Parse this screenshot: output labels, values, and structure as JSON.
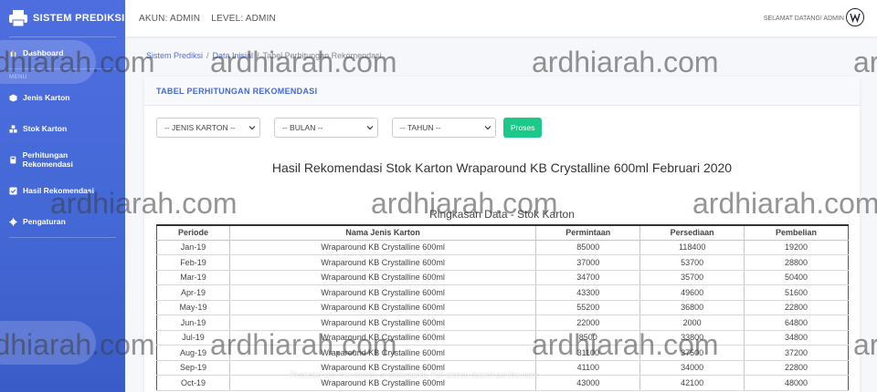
{
  "sidebar": {
    "brand": "SISTEM PREDIKSI",
    "dashboard": "Dashboard",
    "menu_heading": "MENU",
    "items": [
      {
        "label": "Jenis Karton",
        "icon": "box-icon"
      },
      {
        "label": "Stok Karton",
        "icon": "cubes-icon"
      },
      {
        "label": "Perhitungan Rekomendasi",
        "icon": "calculator-icon"
      },
      {
        "label": "Hasil Rekomendasi",
        "icon": "check-square-icon"
      },
      {
        "label": "Pengaturan",
        "icon": "gear-icon"
      }
    ]
  },
  "topbar": {
    "account": "AKUN: ADMIN",
    "level": "LEVEL: ADMIN",
    "greeting": "SELAMAT DATANG! ADMIN"
  },
  "breadcrumb": {
    "root": "Sistem Prediksi",
    "middle": "Data Inisial",
    "current": "Tabel Perhitungan Rekomendasi"
  },
  "card": {
    "header": "TABEL PERHITUNGAN REKOMENDASI",
    "filters": {
      "jenis": "-- JENIS KARTON --",
      "bulan": "-- BULAN --",
      "tahun": "-- TAHUN --",
      "button": "Proses"
    },
    "result_title": "Hasil Rekomendasi Stok Karton Wraparound KB Crystalline 600ml Februari 2020",
    "summary_title": "Ringkasan Data - Stok Karton"
  },
  "table": {
    "headers": [
      "Periode",
      "Nama Jenis Karton",
      "Permintaan",
      "Persediaan",
      "Pembelian"
    ],
    "rows": [
      [
        "Jan-19",
        "Wraparound KB Crystalline 600ml",
        "85000",
        "118400",
        "19200"
      ],
      [
        "Feb-19",
        "Wraparound KB Crystalline 600ml",
        "37000",
        "53700",
        "28800"
      ],
      [
        "Mar-19",
        "Wraparound KB Crystalline 600ml",
        "34700",
        "35700",
        "50400"
      ],
      [
        "Apr-19",
        "Wraparound KB Crystalline 600ml",
        "43300",
        "49600",
        "51600"
      ],
      [
        "May-19",
        "Wraparound KB Crystalline 600ml",
        "55200",
        "36800",
        "22800"
      ],
      [
        "Jun-19",
        "Wraparound KB Crystalline 600ml",
        "22000",
        "2000",
        "64800"
      ],
      [
        "Jul-19",
        "Wraparound KB Crystalline 600ml",
        "8500",
        "33800",
        "34800"
      ],
      [
        "Aug-19",
        "Wraparound KB Crystalline 600ml",
        "31100",
        "37500",
        "37200"
      ],
      [
        "Sep-19",
        "Wraparound KB Crystalline 600ml",
        "41100",
        "34000",
        "22800"
      ],
      [
        "Oct-19",
        "Wraparound KB Crystalline 600ml",
        "43000",
        "42100",
        "48000"
      ]
    ]
  },
  "watermark": "ardhiarah.com",
  "protect_notice": "Protected with free version of Watermarkly. Full version doesn't put this mark."
}
